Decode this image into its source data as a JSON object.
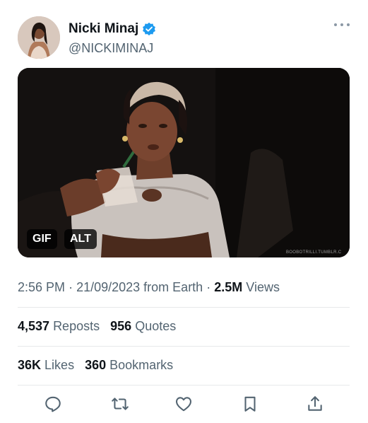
{
  "author": {
    "display_name": "Nicki Minaj",
    "handle": "@NICKIMINAJ",
    "verified": true,
    "verified_color": "#1d9bf0"
  },
  "media": {
    "badges": {
      "gif": "GIF",
      "alt": "ALT"
    },
    "watermark": "BOOBOTRILLI.TUMBLR.C"
  },
  "meta": {
    "time": "2:56 PM",
    "date": "21/09/2023",
    "source": "from Earth",
    "views_count": "2.5M",
    "views_label": "Views"
  },
  "stats": {
    "reposts_count": "4,537",
    "reposts_label": "Reposts",
    "quotes_count": "956",
    "quotes_label": "Quotes",
    "likes_count": "36K",
    "likes_label": "Likes",
    "bookmarks_count": "360",
    "bookmarks_label": "Bookmarks"
  },
  "actions": [
    "reply-icon",
    "repost-icon",
    "like-icon",
    "bookmark-icon",
    "share-icon"
  ],
  "colors": {
    "text": "#0f1419",
    "secondary": "#536471",
    "divider": "#e7e9ea",
    "icon": "#536471"
  }
}
